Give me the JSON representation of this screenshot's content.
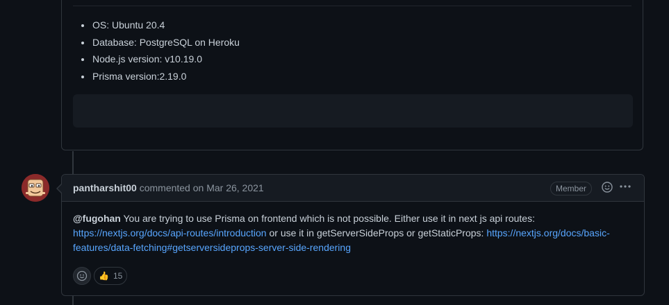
{
  "environment": {
    "items": [
      "OS: Ubuntu 20.4",
      "Database: PostgreSQL on Heroku",
      "Node.js version: v10.19.0",
      "Prisma version:2.19.0"
    ]
  },
  "comment": {
    "author": "pantharshit00",
    "action": "commented on",
    "date": "Mar 26, 2021",
    "badge": "Member",
    "body": {
      "mention": "@fugohan",
      "text1": " You are trying to use Prisma on frontend which is not possible. Either use it in next js api routes: ",
      "link1": "https://nextjs.org/docs/api-routes/introduction",
      "text2": " or use it in getServerSideProps or getStaticProps: ",
      "link2": "https://nextjs.org/docs/basic-features/data-fetching#getserversideprops-server-side-rendering"
    },
    "reactions": [
      {
        "emoji": "thumbs-up",
        "glyph": "👍",
        "count": "15"
      }
    ]
  },
  "icons": {
    "emoji_icon": "smiley-icon",
    "kebab_icon": "kebab-horizontal-icon",
    "add_reaction_icon": "smiley-add-icon"
  },
  "colors": {
    "background": "#0d1117",
    "header_bg": "#161b22",
    "border": "#30363d",
    "link": "#58a6ff",
    "text": "#c9d1d9",
    "muted": "#8b949e"
  }
}
